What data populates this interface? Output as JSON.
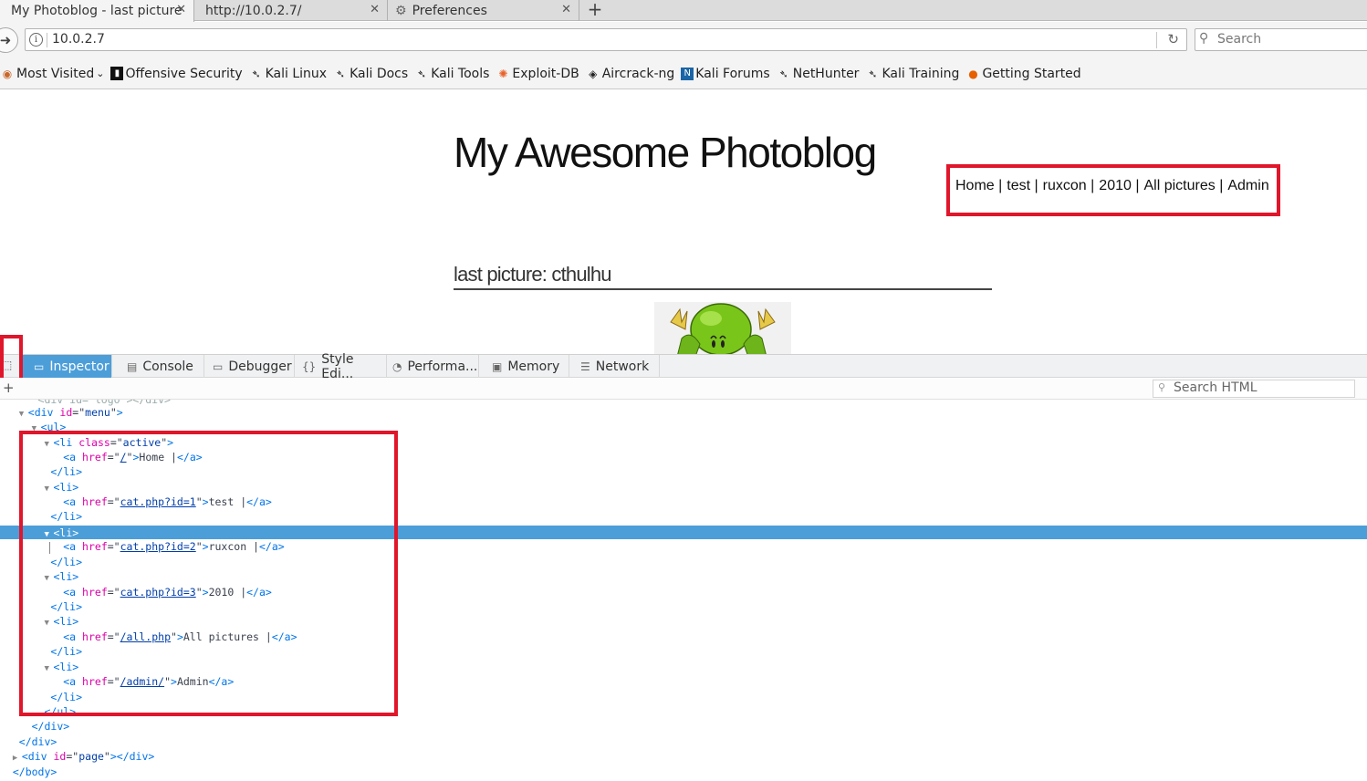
{
  "tabs": [
    {
      "title": "My Photoblog - last picture",
      "active": true
    },
    {
      "title": "http://10.0.2.7/",
      "active": false
    },
    {
      "title": "Preferences",
      "active": false
    }
  ],
  "url": "10.0.2.7",
  "search_placeholder": "Search",
  "bookmarks": [
    "Most Visited",
    "Offensive Security",
    "Kali Linux",
    "Kali Docs",
    "Kali Tools",
    "Exploit-DB",
    "Aircrack-ng",
    "Kali Forums",
    "NetHunter",
    "Kali Training",
    "Getting Started"
  ],
  "page": {
    "title": "My Awesome Photoblog",
    "menu": [
      "Home |",
      "test |",
      "ruxcon |",
      "2010 |",
      "All pictures |",
      "Admin"
    ],
    "picture_title": "last picture: cthulhu"
  },
  "devtools": {
    "tabs": [
      "Inspector",
      "Console",
      "Debugger",
      "Style Edi...",
      "Performa...",
      "Memory",
      "Network"
    ],
    "active_tab": "Inspector",
    "search_html_placeholder": "Search HTML"
  },
  "tree_text": {
    "menu_id": "menu",
    "active_class": "active",
    "home_href": "/",
    "home_text": "Home |",
    "test_href": "cat.php?id=1",
    "test_text": "test |",
    "ruxcon_href": "cat.php?id=2",
    "ruxcon_text": "ruxcon |",
    "y2010_href": "cat.php?id=3",
    "y2010_text": "2010 |",
    "all_href": "/all.php",
    "all_text": "All pictures |",
    "admin_href": "/admin/",
    "admin_text": "Admin",
    "page_id": "page"
  },
  "colors": {
    "highlight": "#e0162b",
    "selection": "#4c9ed9"
  }
}
